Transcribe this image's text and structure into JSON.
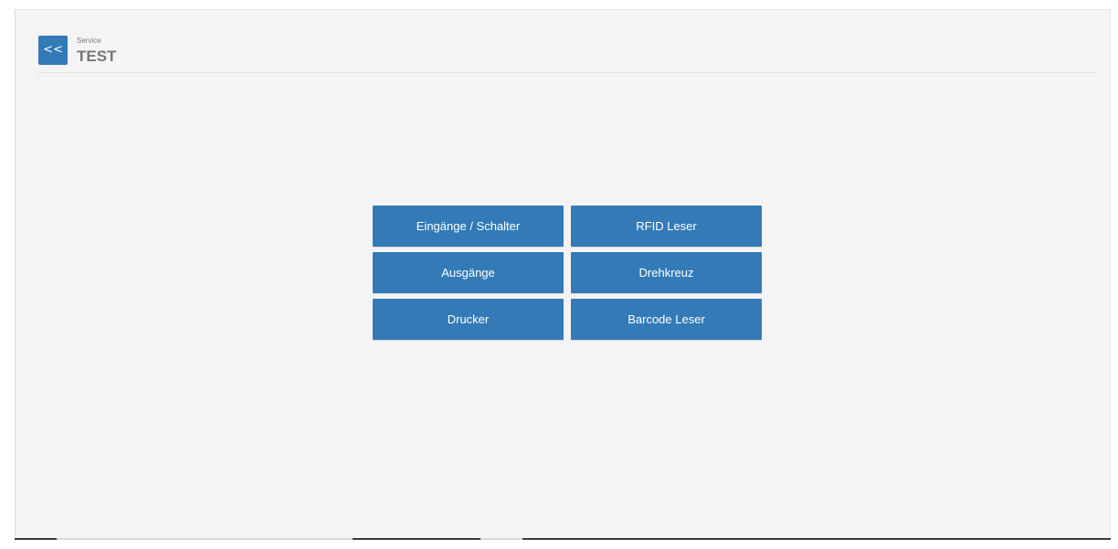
{
  "header": {
    "back_label": "<<",
    "section": "Service",
    "title": "TEST"
  },
  "buttons": [
    {
      "label": "Eingänge / Schalter"
    },
    {
      "label": "RFID Leser"
    },
    {
      "label": "Ausgänge"
    },
    {
      "label": "Drehkreuz"
    },
    {
      "label": "Drucker"
    },
    {
      "label": "Barcode Leser"
    }
  ],
  "colors": {
    "accent": "#337ab7",
    "background": "#f4f4f4",
    "title_text": "#777777"
  }
}
